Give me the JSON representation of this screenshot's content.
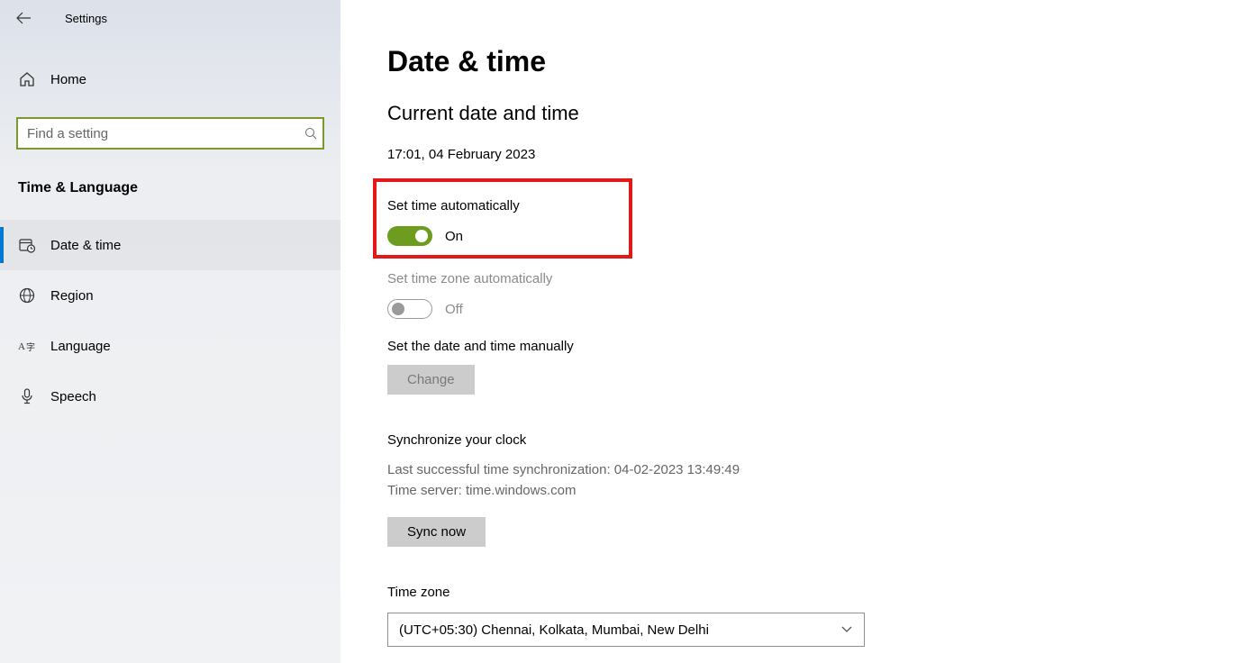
{
  "header": {
    "app_title": "Settings"
  },
  "sidebar": {
    "home_label": "Home",
    "search_placeholder": "Find a setting",
    "category_title": "Time & Language",
    "items": [
      {
        "label": "Date & time",
        "name": "sidebar-item-date-time",
        "active": true
      },
      {
        "label": "Region",
        "name": "sidebar-item-region",
        "active": false
      },
      {
        "label": "Language",
        "name": "sidebar-item-language",
        "active": false
      },
      {
        "label": "Speech",
        "name": "sidebar-item-speech",
        "active": false
      }
    ]
  },
  "main": {
    "page_title": "Date & time",
    "section_title": "Current date and time",
    "current_datetime": "17:01, 04 February 2023",
    "set_time_auto": {
      "label": "Set time automatically",
      "state": "On"
    },
    "set_tz_auto": {
      "label": "Set time zone automatically",
      "state": "Off"
    },
    "manual": {
      "label": "Set the date and time manually",
      "button": "Change"
    },
    "sync": {
      "title": "Synchronize your clock",
      "last_sync": "Last successful time synchronization: 04-02-2023 13:49:49",
      "server": "Time server: time.windows.com",
      "button": "Sync now"
    },
    "timezone": {
      "label": "Time zone",
      "value": "(UTC+05:30) Chennai, Kolkata, Mumbai, New Delhi"
    }
  }
}
